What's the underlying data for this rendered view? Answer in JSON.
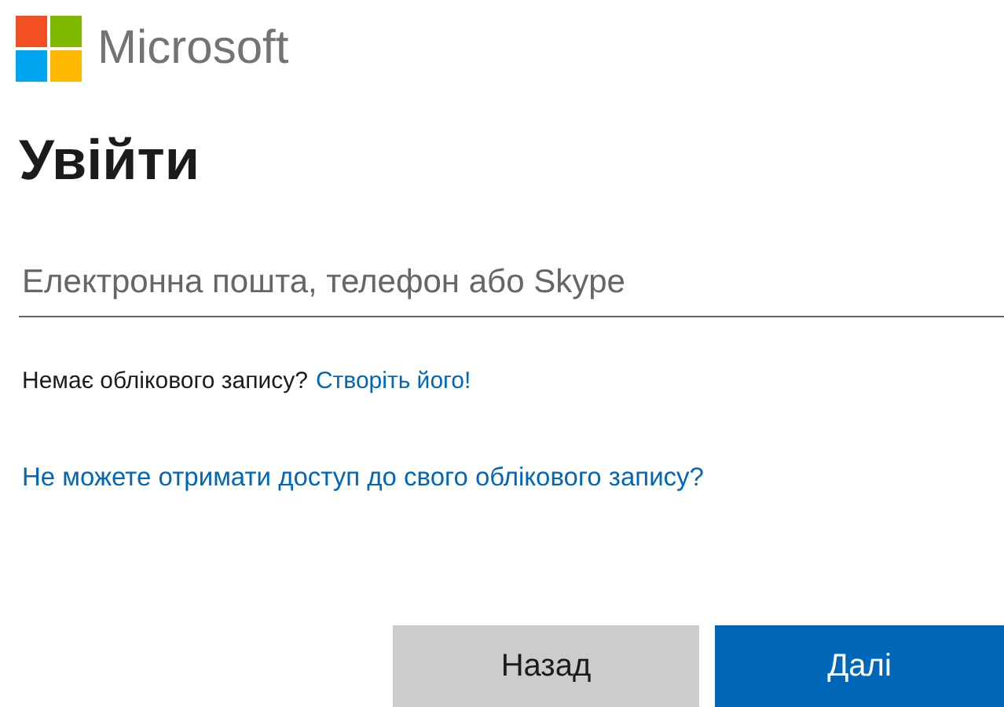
{
  "brand": {
    "name": "Microsoft"
  },
  "title": "Увійти",
  "email_field": {
    "placeholder": "Електронна пошта, телефон або Skype"
  },
  "no_account": {
    "text": "Немає облікового запису?",
    "link": "Створіть його!"
  },
  "cant_access_link": "Не можете отримати доступ до свого облікового запису?",
  "buttons": [
    {
      "label": "Назад",
      "kind": "secondary"
    },
    {
      "label": "Далі",
      "kind": "primary"
    }
  ]
}
